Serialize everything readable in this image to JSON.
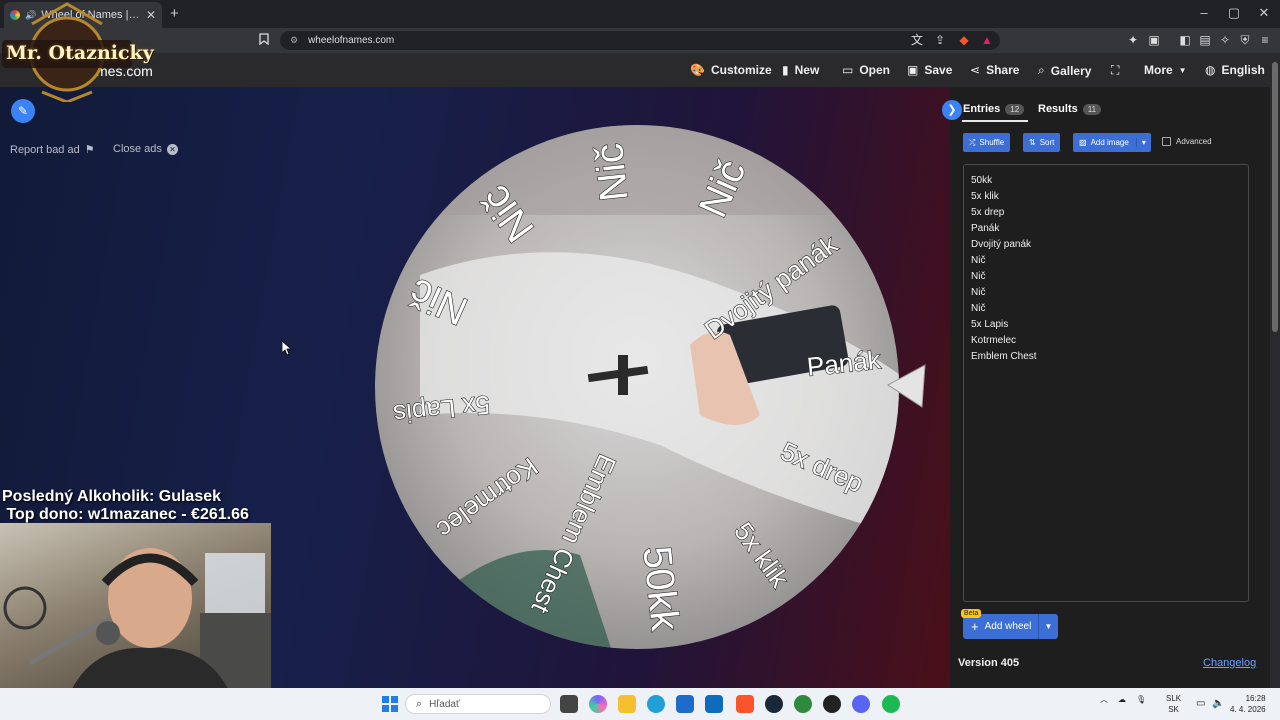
{
  "browser": {
    "tab_title": "Wheel of Names | Random na",
    "tab_close": "✕",
    "new_tab": "+",
    "url": "wheelofnames.com",
    "window_controls": [
      "–",
      "▢",
      "✕"
    ]
  },
  "site": {
    "logo_text": "mes.com",
    "nav": {
      "customize": "Customize",
      "new": "New",
      "open": "Open",
      "save": "Save",
      "share": "Share",
      "gallery": "Gallery",
      "more": "More",
      "language": "English"
    },
    "report_bad_ad": "Report bad ad",
    "close_ads": "Close ads"
  },
  "wheel": {
    "segments": [
      "Panák",
      "5x drep",
      "5x klik",
      "50kk",
      "Emblem Chest",
      "Kotrmelec",
      "5x Lapis",
      "Nič",
      "Nič",
      "Nič",
      "Nič",
      "Dvojitý panák"
    ]
  },
  "panel": {
    "tabs": {
      "entries_label": "Entries",
      "entries_count": "12",
      "results_label": "Results",
      "results_count": "11"
    },
    "buttons": {
      "shuffle": "Shuffle",
      "sort": "Sort",
      "add_image": "Add image",
      "advanced": "Advanced"
    },
    "entries": [
      "50kk",
      "5x klik",
      "5x drep",
      "Panák",
      "Dvojitý panák",
      "Nič",
      "Nič",
      "Nič",
      "Nič",
      "5x Lapis",
      "Kotrmelec",
      "Emblem Chest"
    ],
    "beta": "Beta",
    "add_wheel": "Add wheel",
    "version": "Version 405",
    "changelog": "Changelog"
  },
  "overlay": {
    "channel_logo": "Mr. Otaznicky",
    "line1": "Posledný Alkoholik: Gulasek",
    "line2": " Top dono: w1mazanec - €261.66"
  },
  "taskbar": {
    "search_placeholder": "Hľadať",
    "lang_top": "SLK",
    "lang_bottom": "SK",
    "time": "16:28",
    "date": "4. 4. 2026"
  }
}
